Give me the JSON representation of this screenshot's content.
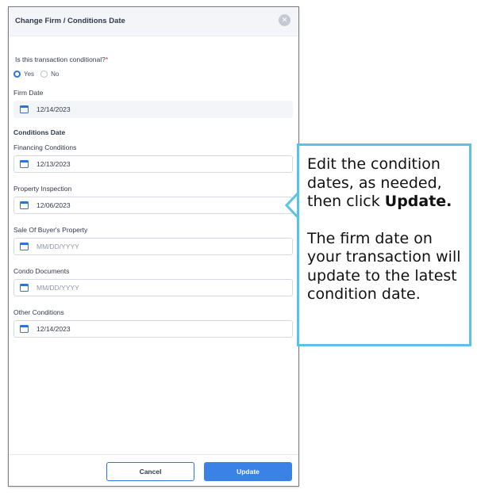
{
  "dialog": {
    "title": "Change Firm / Conditions Date",
    "close_glyph": "✕",
    "question": "Is this transaction conditional?",
    "required_mark": "*",
    "radio_yes": "Yes",
    "radio_no": "No",
    "selected": "Yes",
    "firm_date_label": "Firm Date",
    "firm_date_value": "12/14/2023",
    "conditions_heading": "Conditions Date",
    "fields": [
      {
        "label": "Financing Conditions",
        "value": "12/13/2023"
      },
      {
        "label": "Property Inspection",
        "value": "12/06/2023"
      },
      {
        "label": "Sale Of Buyer's Property",
        "value": "",
        "placeholder": "MM/DD/YYYY"
      },
      {
        "label": "Condo Documents",
        "value": "",
        "placeholder": "MM/DD/YYYY"
      },
      {
        "label": "Other Conditions",
        "value": "12/14/2023"
      }
    ],
    "cancel_label": "Cancel",
    "update_label": "Update"
  },
  "callout": {
    "line1_text": "Edit the condition dates, as needed, then click ",
    "line1_bold": "Update.",
    "line2": "The firm date on your transaction will update to the latest condition date."
  },
  "colors": {
    "accent": "#2e74d6",
    "primary_button": "#3b82e6",
    "callout_border": "#5bc3ea",
    "required": "#e03a3a"
  },
  "icons": {
    "close": "close-icon",
    "date": "calendar-icon"
  }
}
